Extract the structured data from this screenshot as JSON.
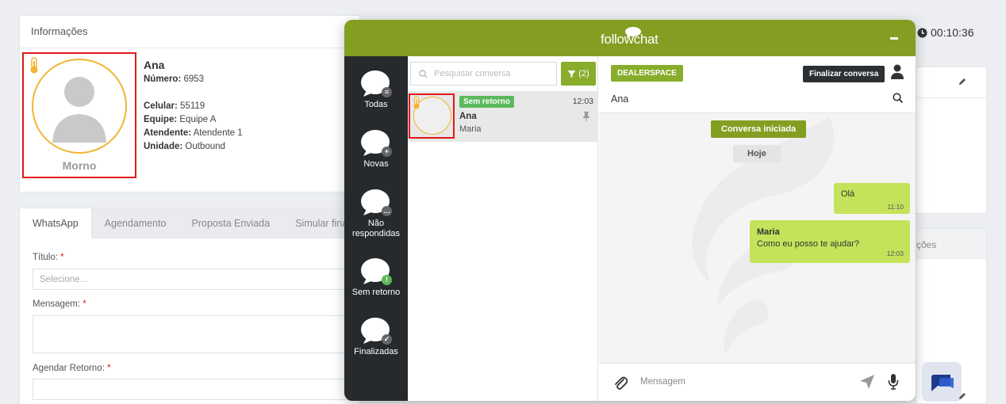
{
  "info": {
    "title": "Informações",
    "temperature": "Morno",
    "name": "Ana",
    "numero_label": "Número:",
    "numero": "6953",
    "celular_label": "Celular:",
    "celular": "55119",
    "equipe_label": "Equipe:",
    "equipe": "Equipe A",
    "atendente_label": "Atendente:",
    "atendente": "Atendente 1",
    "unidade_label": "Unidade:",
    "unidade": "Outbound"
  },
  "timer": "00:10:36",
  "right_panel": {
    "partial_header": "ções"
  },
  "tabs": [
    "WhatsApp",
    "Agendamento",
    "Proposta Enviada",
    "Simular finan"
  ],
  "form": {
    "titulo_label": "Título:",
    "titulo_placeholder": "Selecione...",
    "mensagem_label": "Mensagem:",
    "agendar_label": "Agendar Retorno:",
    "required_mark": "*"
  },
  "widget": {
    "logo": "followchat",
    "nav": [
      {
        "label": "Todas",
        "icon": "list-badge-icon"
      },
      {
        "label": "Novas",
        "icon": "plus-badge-icon"
      },
      {
        "label": "Não respondidas",
        "icon": "dots-badge-icon"
      },
      {
        "label": "Sem retorno",
        "icon": "exclamation-badge-icon"
      },
      {
        "label": "Finalizadas",
        "icon": "check-badge-icon"
      }
    ],
    "search_placeholder": "Pesquisar conversa",
    "filter_count": "(2)",
    "conversation": {
      "badge": "Sem retorno",
      "time": "12:03",
      "name": "Ana",
      "agent": "Maria"
    },
    "chat": {
      "tag": "DEALERSPACE",
      "finish_button": "Finalizar conversa",
      "contact": "Ana",
      "started": "Conversa iniciada",
      "day": "Hoje",
      "messages": [
        {
          "text": "Olá",
          "time": "11:10"
        },
        {
          "author": "Maria",
          "text": "Como eu posso te ajudar?",
          "time": "12:03"
        }
      ],
      "input_placeholder": "Mensagem"
    },
    "colors": {
      "header": "#849e21",
      "accent": "#88ad2b",
      "sidebar": "#262a2d",
      "bubble": "#c4e35a"
    }
  }
}
